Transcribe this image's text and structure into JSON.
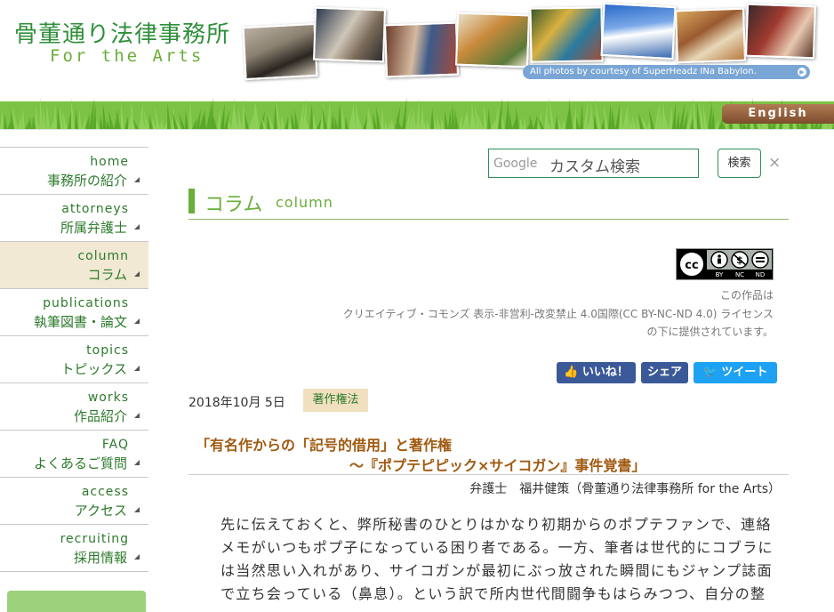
{
  "header": {
    "title": "骨董通り法律事務所",
    "subtitle": "For the Arts",
    "photo_credit": "All photos by courtesy of SuperHeadz INa Babylon.",
    "english_button": "English"
  },
  "sidebar": {
    "items": [
      {
        "en": "home",
        "jp": "事務所の紹介"
      },
      {
        "en": "attorneys",
        "jp": "所属弁護士"
      },
      {
        "en": "column",
        "jp": "コラム",
        "active": true
      },
      {
        "en": "publications",
        "jp": "執筆図書・論文"
      },
      {
        "en": "topics",
        "jp": "トピックス"
      },
      {
        "en": "works",
        "jp": "作品紹介"
      },
      {
        "en": "FAQ",
        "jp": "よくあるご質問"
      },
      {
        "en": "access",
        "jp": "アクセス"
      },
      {
        "en": "recruiting",
        "jp": "採用情報"
      }
    ]
  },
  "search": {
    "brand": "Google",
    "placeholder": "カスタム検索",
    "button": "検索",
    "close": "×"
  },
  "page_heading": {
    "jp": "コラム",
    "en": "column"
  },
  "license": {
    "badge_labels": [
      "cc",
      "BY",
      "NC",
      "ND"
    ],
    "lines": [
      "この作品は",
      "クリエイティブ・コモンズ 表示-非営利-改変禁止 4.0国際(CC BY-NC-ND 4.0) ライセンス",
      "の下に提供されています。"
    ]
  },
  "social": {
    "like": "いいね！",
    "share": "シェア",
    "tweet": "ツイート"
  },
  "article": {
    "date": "2018年10月 5日",
    "category": "著作権法",
    "title_line1": "「有名作からの「記号的借用」と著作権",
    "title_line2": "～『ポプテピピック×サイコガン』事件覚書」",
    "author": "弁護士　福井健策（骨董通り法律事務所 for the Arts）",
    "paragraph_lines": [
      "先に伝えておくと、弊所秘書のひとりはかなり初期からのポプテファンで、連絡",
      "メモがいつもポプ子になっている困り者である。一方、筆者は世代的にコブラに",
      "は当然思い入れがあり、サイコガンが最初にぶっ放された瞬間にもジャンプ誌面",
      "で立ち会っている（鼻息）。という訳で所内世代間闘争もはらみつつ、自分の整"
    ]
  },
  "colors": {
    "brand_green": "#2f8f3a",
    "title_brown": "#a05a10",
    "facebook": "#3b5998",
    "twitter": "#1da1f2"
  }
}
